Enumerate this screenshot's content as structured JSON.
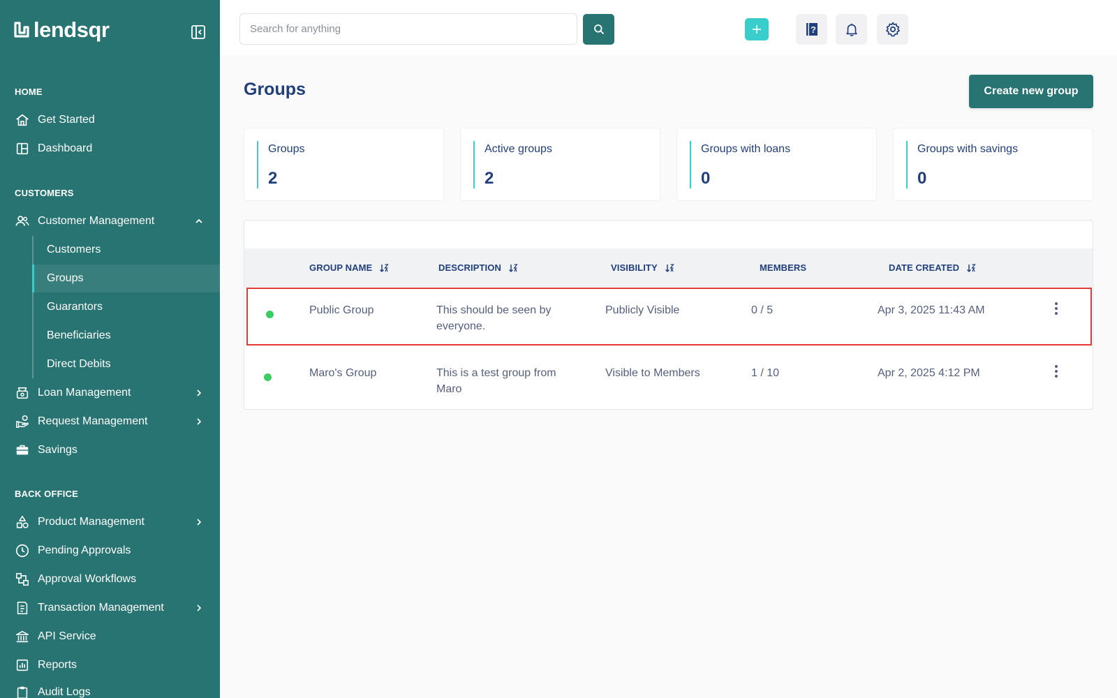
{
  "brand": {
    "name": "lendsqr"
  },
  "sidebar": {
    "sections": {
      "home": "HOME",
      "customers": "CUSTOMERS",
      "back_office": "BACK OFFICE"
    },
    "home_items": [
      {
        "label": "Get Started",
        "icon": "home-icon"
      },
      {
        "label": "Dashboard",
        "icon": "dashboard-icon"
      }
    ],
    "customer_management": {
      "label": "Customer Management",
      "icon": "users-icon",
      "expanded": true,
      "children": [
        "Customers",
        "Groups",
        "Guarantors",
        "Beneficiaries",
        "Direct Debits"
      ],
      "active_child": "Groups"
    },
    "customer_items": [
      {
        "label": "Loan Management",
        "icon": "loan-icon",
        "has_children": true
      },
      {
        "label": "Request Management",
        "icon": "hand-coin-icon",
        "has_children": true
      },
      {
        "label": "Savings",
        "icon": "briefcase-icon",
        "has_children": false
      }
    ],
    "back_office_items": [
      {
        "label": "Product Management",
        "icon": "shapes-icon",
        "has_children": true
      },
      {
        "label": "Pending Approvals",
        "icon": "clock-icon",
        "has_children": false
      },
      {
        "label": "Approval Workflows",
        "icon": "workflow-icon",
        "has_children": false
      },
      {
        "label": "Transaction Management",
        "icon": "ledger-icon",
        "has_children": true
      },
      {
        "label": "API Service",
        "icon": "bank-icon",
        "has_children": false
      },
      {
        "label": "Reports",
        "icon": "chart-icon",
        "has_children": false
      },
      {
        "label": "Audit Logs",
        "icon": "clipboard-icon",
        "has_children": false
      }
    ]
  },
  "topbar": {
    "search": {
      "placeholder": "Search for anything",
      "value": ""
    }
  },
  "page": {
    "title": "Groups",
    "create_button": "Create new group"
  },
  "stats": [
    {
      "label": "Groups",
      "value": "2"
    },
    {
      "label": "Active groups",
      "value": "2"
    },
    {
      "label": "Groups with loans",
      "value": "0"
    },
    {
      "label": "Groups with savings",
      "value": "0"
    }
  ],
  "table": {
    "columns": [
      "GROUP NAME",
      "DESCRIPTION",
      "VISIBILITY",
      "MEMBERS",
      "DATE CREATED"
    ],
    "rows": [
      {
        "status": "active",
        "name": "Public Group",
        "description_line1": "This should be seen by",
        "description_line2": "everyone.",
        "visibility": "Publicly Visible",
        "members": "0 / 5",
        "date_created": "Apr 3, 2025 11:43 AM",
        "selected": true
      },
      {
        "status": "active",
        "name": "Maro's Group",
        "description_line1": "This is a test group from",
        "description_line2": "Maro",
        "visibility": "Visible to Members",
        "members": "1 / 10",
        "date_created": "Apr 2, 2025 4:12 PM",
        "selected": false
      }
    ]
  },
  "colors": {
    "sidebar_bg": "#277472",
    "accent": "#39cdcc",
    "text_primary": "#213f7d",
    "text_secondary": "#545f7d",
    "status_active": "#39cd62",
    "selection_outline": "#e53935"
  }
}
